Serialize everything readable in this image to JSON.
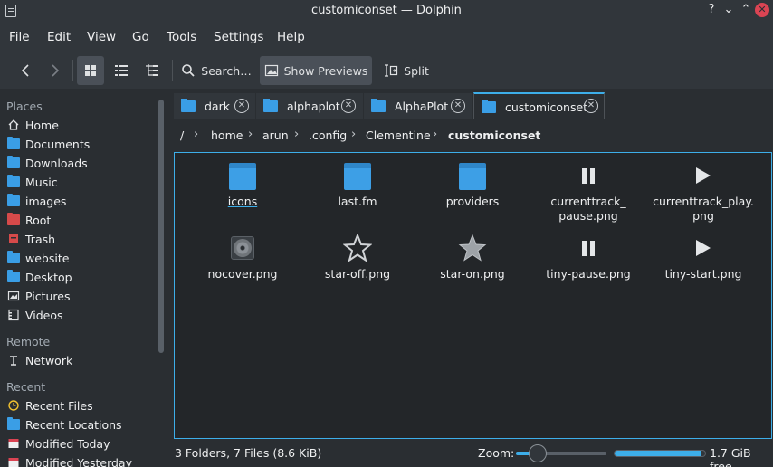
{
  "window": {
    "title": "customiconset — Dolphin",
    "controls": {
      "help": "?",
      "minimize": "⌄",
      "maximize": "⌃",
      "close": "✕"
    }
  },
  "menubar": [
    "File",
    "Edit",
    "View",
    "Go",
    "Tools",
    "Settings",
    "Help"
  ],
  "toolbar": {
    "search_label": "Search…",
    "show_previews_label": "Show Previews",
    "split_label": "Split"
  },
  "sidebar": {
    "places_title": "Places",
    "places": [
      {
        "label": "Home",
        "icon": "home-icon"
      },
      {
        "label": "Documents",
        "icon": "folder-icon"
      },
      {
        "label": "Downloads",
        "icon": "folder-icon"
      },
      {
        "label": "Music",
        "icon": "folder-icon"
      },
      {
        "label": "images",
        "icon": "folder-icon"
      },
      {
        "label": "Root",
        "icon": "folder-red-icon"
      },
      {
        "label": "Trash",
        "icon": "trash-icon"
      },
      {
        "label": "website",
        "icon": "folder-icon"
      },
      {
        "label": "Desktop",
        "icon": "folder-icon"
      },
      {
        "label": "Pictures",
        "icon": "pictures-icon"
      },
      {
        "label": "Videos",
        "icon": "videos-icon"
      }
    ],
    "remote_title": "Remote",
    "remote": [
      {
        "label": "Network",
        "icon": "network-icon"
      }
    ],
    "recent_title": "Recent",
    "recent": [
      {
        "label": "Recent Files",
        "icon": "clock-icon"
      },
      {
        "label": "Recent Locations",
        "icon": "folder-icon"
      },
      {
        "label": "Modified Today",
        "icon": "calendar-icon"
      },
      {
        "label": "Modified Yesterday",
        "icon": "calendar-icon"
      }
    ]
  },
  "tabs": [
    {
      "label": "dark",
      "active": false
    },
    {
      "label": "alphaplot",
      "active": false
    },
    {
      "label": "AlphaPlot",
      "active": false
    },
    {
      "label": "customiconset",
      "active": true
    }
  ],
  "breadcrumb": [
    "/",
    "home",
    "arun",
    ".config",
    "Clementine",
    "customiconset"
  ],
  "files": [
    {
      "name": "icons",
      "kind": "folder"
    },
    {
      "name": "last.fm",
      "kind": "folder"
    },
    {
      "name": "providers",
      "kind": "folder"
    },
    {
      "name": "currenttrack_\npause.png",
      "kind": "pause"
    },
    {
      "name": "currenttrack_play.\npng",
      "kind": "play"
    },
    {
      "name": "nocover.png",
      "kind": "cd"
    },
    {
      "name": "star-off.png",
      "kind": "star-off"
    },
    {
      "name": "star-on.png",
      "kind": "star-on"
    },
    {
      "name": "tiny-pause.png",
      "kind": "pause"
    },
    {
      "name": "tiny-start.png",
      "kind": "play"
    }
  ],
  "status": {
    "summary": "3 Folders, 7 Files (8.6 KiB)",
    "zoom_label": "Zoom:",
    "zoom_level": 0.18,
    "disk_used_fraction": 0.96,
    "free_space": "1.7 GiB free"
  },
  "colors": {
    "accent": "#3daee9",
    "folder": "#3d9fe6",
    "close": "#da4453"
  }
}
